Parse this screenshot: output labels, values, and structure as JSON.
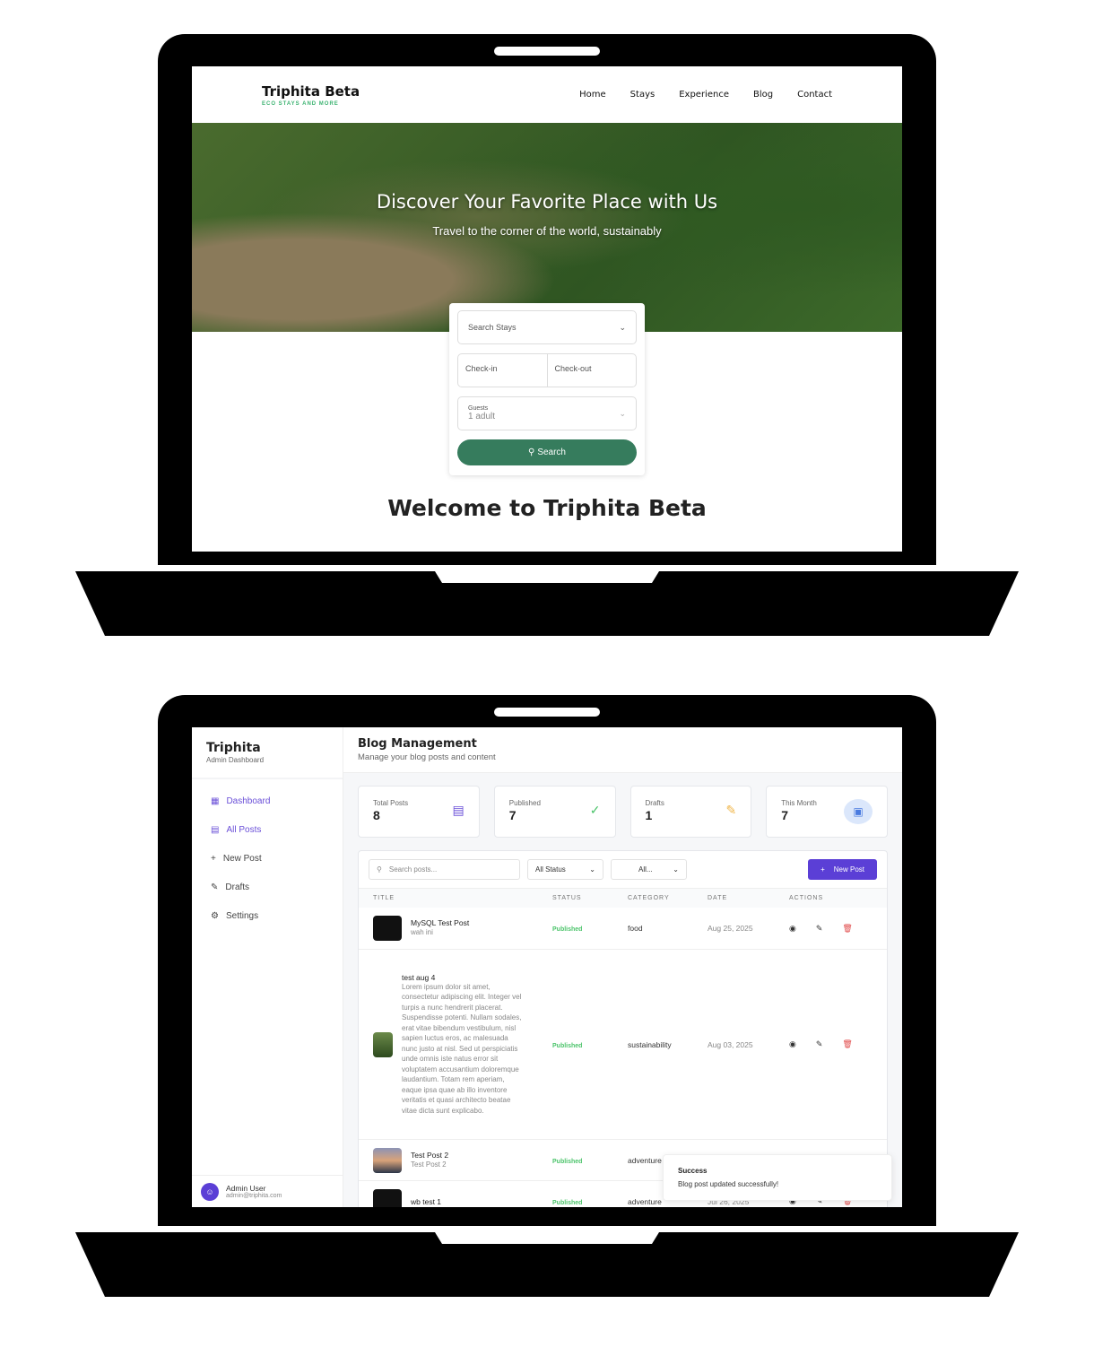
{
  "site": {
    "logo": "Triphita Beta",
    "tagline": "ECO STAYS AND MORE",
    "nav": [
      "Home",
      "Stays",
      "Experience",
      "Blog",
      "Contact"
    ],
    "hero_title": "Discover Your Favorite Place with Us",
    "hero_subtitle": "Travel to the corner of the world, sustainably",
    "search": {
      "stays": "Search Stays",
      "checkin": "Check-in",
      "checkout": "Check-out",
      "guests_label": "Guests",
      "guests_value": "1 adult",
      "button": "Search"
    },
    "welcome": "Welcome to Triphita Beta"
  },
  "admin": {
    "brand": "Triphita",
    "brand_sub": "Admin Dashboard",
    "sidebar": [
      {
        "label": "Dashboard",
        "icon": "grid-icon"
      },
      {
        "label": "All Posts",
        "icon": "document-icon"
      },
      {
        "label": "New Post",
        "icon": "plus-icon"
      },
      {
        "label": "Drafts",
        "icon": "edit-icon"
      },
      {
        "label": "Settings",
        "icon": "gear-icon"
      }
    ],
    "user": {
      "name": "Admin User",
      "email": "admin@triphita.com"
    },
    "title": "Blog Management",
    "subtitle": "Manage your blog posts and content",
    "stats": [
      {
        "label": "Total Posts",
        "value": "8",
        "color": "#6a4fd8"
      },
      {
        "label": "Published",
        "value": "7",
        "color": "#4cc46b"
      },
      {
        "label": "Drafts",
        "value": "1",
        "color": "#f0b64a"
      },
      {
        "label": "This Month",
        "value": "7",
        "color": "#4a7be0"
      }
    ],
    "search_placeholder": "Search posts...",
    "status_filter": "All Status",
    "category_filter": "All...",
    "new_post": "New Post",
    "columns": [
      "TITLE",
      "STATUS",
      "CATEGORY",
      "DATE",
      "ACTIONS"
    ],
    "posts": [
      {
        "title": "MySQL Test Post",
        "excerpt": "wah ini",
        "status": "Published",
        "category": "food",
        "date": "Aug 25, 2025"
      },
      {
        "title": "test aug 4",
        "excerpt": "Lorem ipsum dolor sit amet, consectetur adipiscing elit. Integer vel turpis a nunc hendrerit placerat. Suspendisse potenti. Nullam sodales, erat vitae bibendum vestibulum, nisl sapien luctus eros, ac malesuada nunc justo at nisl. Sed ut perspiciatis unde omnis iste natus error sit voluptatem accusantium doloremque laudantium. Totam rem aperiam, eaque ipsa quae ab illo inventore veritatis et quasi architecto beatae vitae dicta sunt explicabo.",
        "status": "Published",
        "category": "sustainability",
        "date": "Aug 03, 2025"
      },
      {
        "title": "Test Post 2",
        "excerpt": "Test Post 2",
        "status": "Published",
        "category": "adventure",
        "date": ""
      },
      {
        "title": "wb test 1",
        "excerpt": "",
        "status": "Published",
        "category": "adventure",
        "date": "Jul 26, 2025"
      }
    ],
    "toast": {
      "title": "Success",
      "message": "Blog post updated successfully!"
    }
  }
}
